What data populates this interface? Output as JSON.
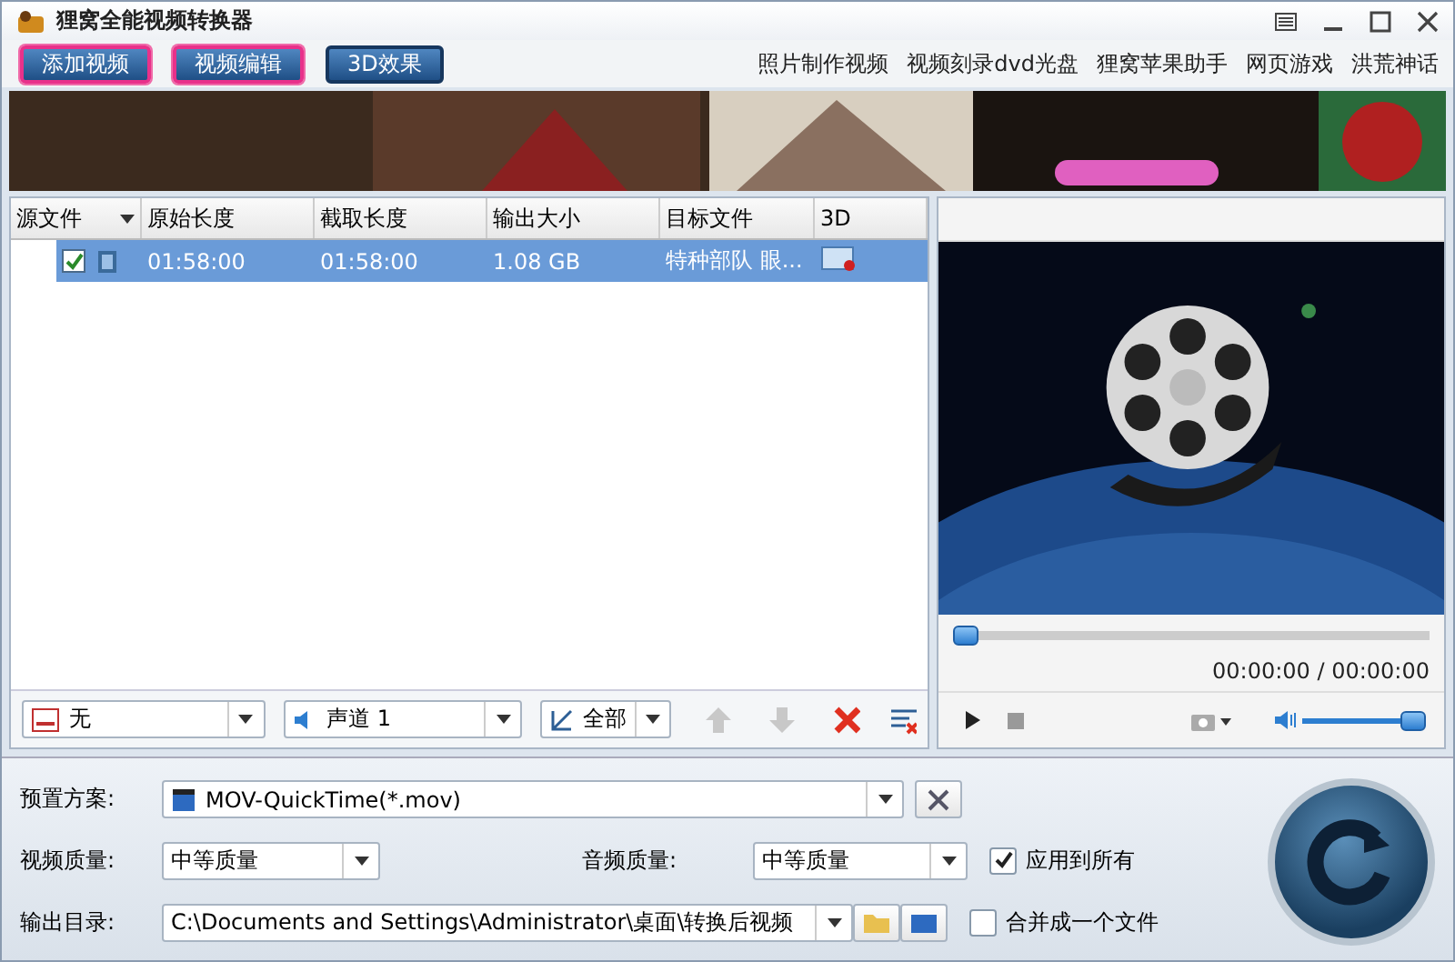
{
  "window": {
    "title": "狸窝全能视频转换器"
  },
  "toolbar": {
    "buttons": [
      {
        "label": "添加视频",
        "highlighted": true
      },
      {
        "label": "视频编辑",
        "highlighted": true
      },
      {
        "label": "3D效果",
        "highlighted": false
      }
    ],
    "links": [
      "照片制作视频",
      "视频刻录dvd光盘",
      "狸窝苹果助手",
      "网页游戏",
      "洪荒神话"
    ]
  },
  "file_table": {
    "columns": [
      "源文件",
      "原始长度",
      "截取长度",
      "输出大小",
      "目标文件",
      "3D"
    ],
    "rows": [
      {
        "checked": true,
        "selected": true,
        "original_length": "01:58:00",
        "clip_length": "01:58:00",
        "output_size": "1.08 GB",
        "target_file": "特种部队 眼..."
      }
    ]
  },
  "list_toolbar": {
    "subtitle": "无",
    "audio_track": "声道 1",
    "range": "全部"
  },
  "preview": {
    "kind": "picture",
    "seek": {
      "level": 0
    },
    "time": "00:00:00 / 00:00:00",
    "volume": {
      "level": 1
    }
  },
  "settings": {
    "preset_label": "预置方案:",
    "preset": "MOV-QuickTime(*.mov)",
    "video_quality_label": "视频质量:",
    "video_quality": "中等质量",
    "audio_quality_label": "音频质量:",
    "audio_quality": "中等质量",
    "apply_all": {
      "label": "应用到所有",
      "checked": true
    },
    "output_dir_label": "输出目录:",
    "output_dir": "C:\\Documents and Settings\\Administrator\\桌面\\转换后视频",
    "merge": {
      "label": "合并成一个文件",
      "checked": false
    }
  }
}
